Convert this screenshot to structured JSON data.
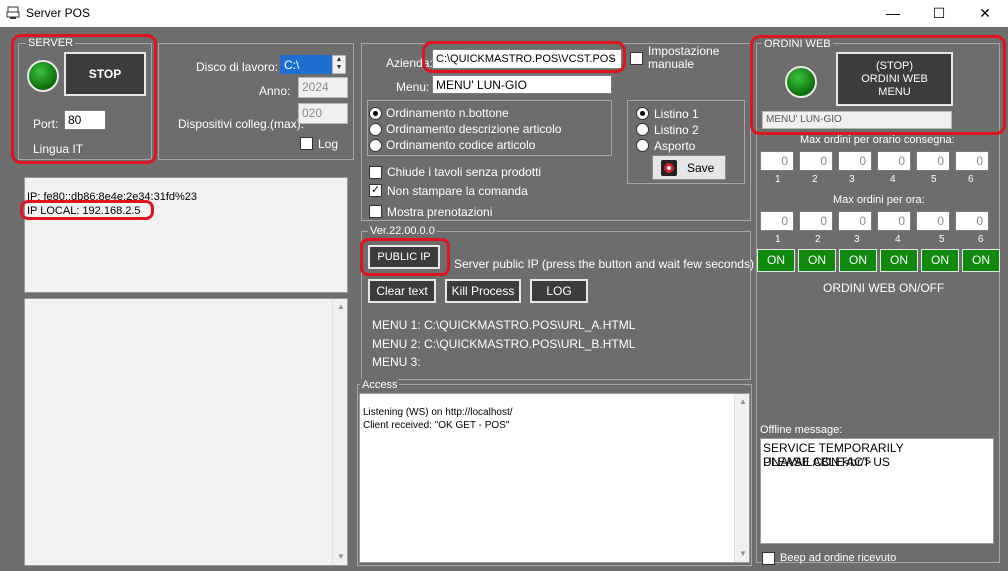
{
  "window": {
    "title": "Server POS",
    "minimize": "—",
    "maximize": "☐",
    "close": "✕"
  },
  "server": {
    "legend": "SERVER",
    "stop_label": "STOP",
    "port_label": "Port:",
    "port_value": "80",
    "lingua": "Lingua IT"
  },
  "work": {
    "disco_label": "Disco di lavoro:",
    "disco_value": "C:\\",
    "anno_label": "Anno:",
    "anno_value": "2024",
    "dispositivi_label": "Dispositivi colleg.(max):",
    "dispositivi_value": "020",
    "log_label": "Log"
  },
  "ip": {
    "ipv6": "IP: fe80::db86:8e4e:2e34:31fd%23",
    "local": "IP LOCAL: 192.168.2.5"
  },
  "azienda": {
    "label": "Azienda:",
    "value": "C:\\QUICKMASTRO.POS\\VCST.POS",
    "impostazione_label": "Impostazione manuale",
    "menu_label": "Menu:",
    "menu_value": "MENU' LUN-GIO"
  },
  "ordinamento": {
    "options": [
      "Ordinamento n.bottone",
      "Ordinamento descrizione articolo",
      "Ordinamento codice articolo"
    ],
    "selected": 0
  },
  "options": {
    "chiude": "Chiude i tavoli senza prodotti",
    "non_stampare": "Non stampare la comanda",
    "mostra": "Mostra prenotazioni"
  },
  "listino": {
    "options": [
      "Listino 1",
      "Listino 2",
      "Asporto"
    ],
    "selected": 0,
    "save_label": "Save"
  },
  "version": {
    "legend": "Ver.22.00.0.0",
    "public_ip_label": "PUBLIC IP",
    "public_ip_note": "Server public IP (press the button and wait few seconds)",
    "clear_label": "Clear text",
    "kill_label": "Kill Process",
    "log_label": "LOG",
    "menu1": "MENU 1: C:\\QUICKMASTRO.POS\\URL_A.HTML",
    "menu2": "MENU 2: C:\\QUICKMASTRO.POS\\URL_B.HTML",
    "menu3": "MENU 3:"
  },
  "access": {
    "legend": "Access",
    "line1": "Listening (WS) on http://localhost/",
    "line2": "Client received: \"OK GET - POS\""
  },
  "ordini_web": {
    "legend": "ORDINI WEB",
    "stop_line1": "(STOP)",
    "stop_line2": "ORDINI WEB",
    "stop_line3": "MENU",
    "menu_value": "MENU' LUN-GIO",
    "max_orario_label": "Max ordini per orario consegna:",
    "max_ora_label": "Max ordini per ora:",
    "slots": [
      "1",
      "2",
      "3",
      "4",
      "5",
      "6"
    ],
    "orario_values": [
      "0",
      "0",
      "0",
      "0",
      "0",
      "0"
    ],
    "ora_values": [
      "0",
      "0",
      "0",
      "0",
      "0",
      "0"
    ],
    "on_labels": [
      "ON",
      "ON",
      "ON",
      "ON",
      "ON",
      "ON"
    ],
    "onoff_label": "ORDINI WEB ON/OFF",
    "offline_label": "Offline message:",
    "offline_line1": "SERVICE TEMPORARILY UNAVAILABLE<br/>",
    "offline_line2": "PLEASE CONTACT US",
    "beep_label": "Beep ad ordine ricevuto"
  }
}
